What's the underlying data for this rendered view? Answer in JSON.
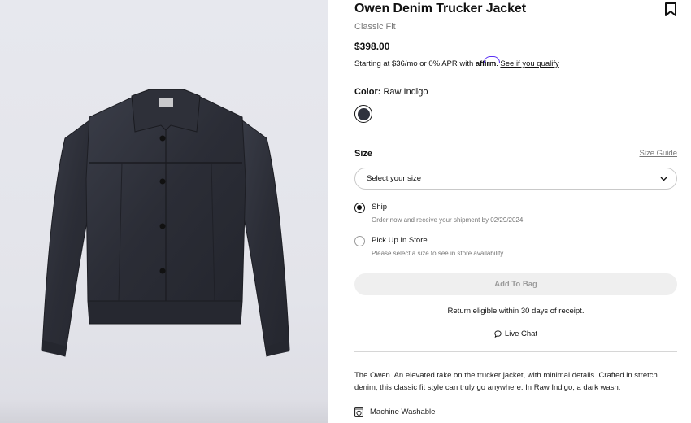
{
  "product": {
    "name": "Owen Denim Trucker Jacket",
    "fit": "Classic Fit",
    "price": "$398.00",
    "image_icon": "denim-jacket-photo"
  },
  "financing": {
    "text": "Starting at $36/mo or 0% APR with",
    "brand": "affirm",
    "link": "See if you qualify"
  },
  "color": {
    "label": "Color:",
    "value": "Raw Indigo",
    "swatch_hex": "#2f323d"
  },
  "size": {
    "label": "Size",
    "guide_link": "Size Guide",
    "select_placeholder": "Select your size"
  },
  "fulfillment": [
    {
      "label": "Ship",
      "sub": "Order now and receive your shipment by 02/29/2024",
      "selected": true
    },
    {
      "label": "Pick Up In Store",
      "sub": "Please select a size to see in store availability",
      "selected": false
    }
  ],
  "actions": {
    "add_to_bag": "Add To Bag",
    "return_note": "Return eligible within 30 days of receipt.",
    "live_chat": "Live Chat"
  },
  "description": "The Owen. An elevated take on the trucker jacket, with minimal details. Crafted in stretch denim, this classic fit style can truly go anywhere. In Raw Indigo, a dark wash.",
  "care": {
    "label": "Machine Washable",
    "icon": "washing-machine-icon"
  },
  "icons": [
    "bookmark-icon",
    "chevron-down-icon",
    "chat-bubble-icon",
    "washing-machine-icon"
  ]
}
